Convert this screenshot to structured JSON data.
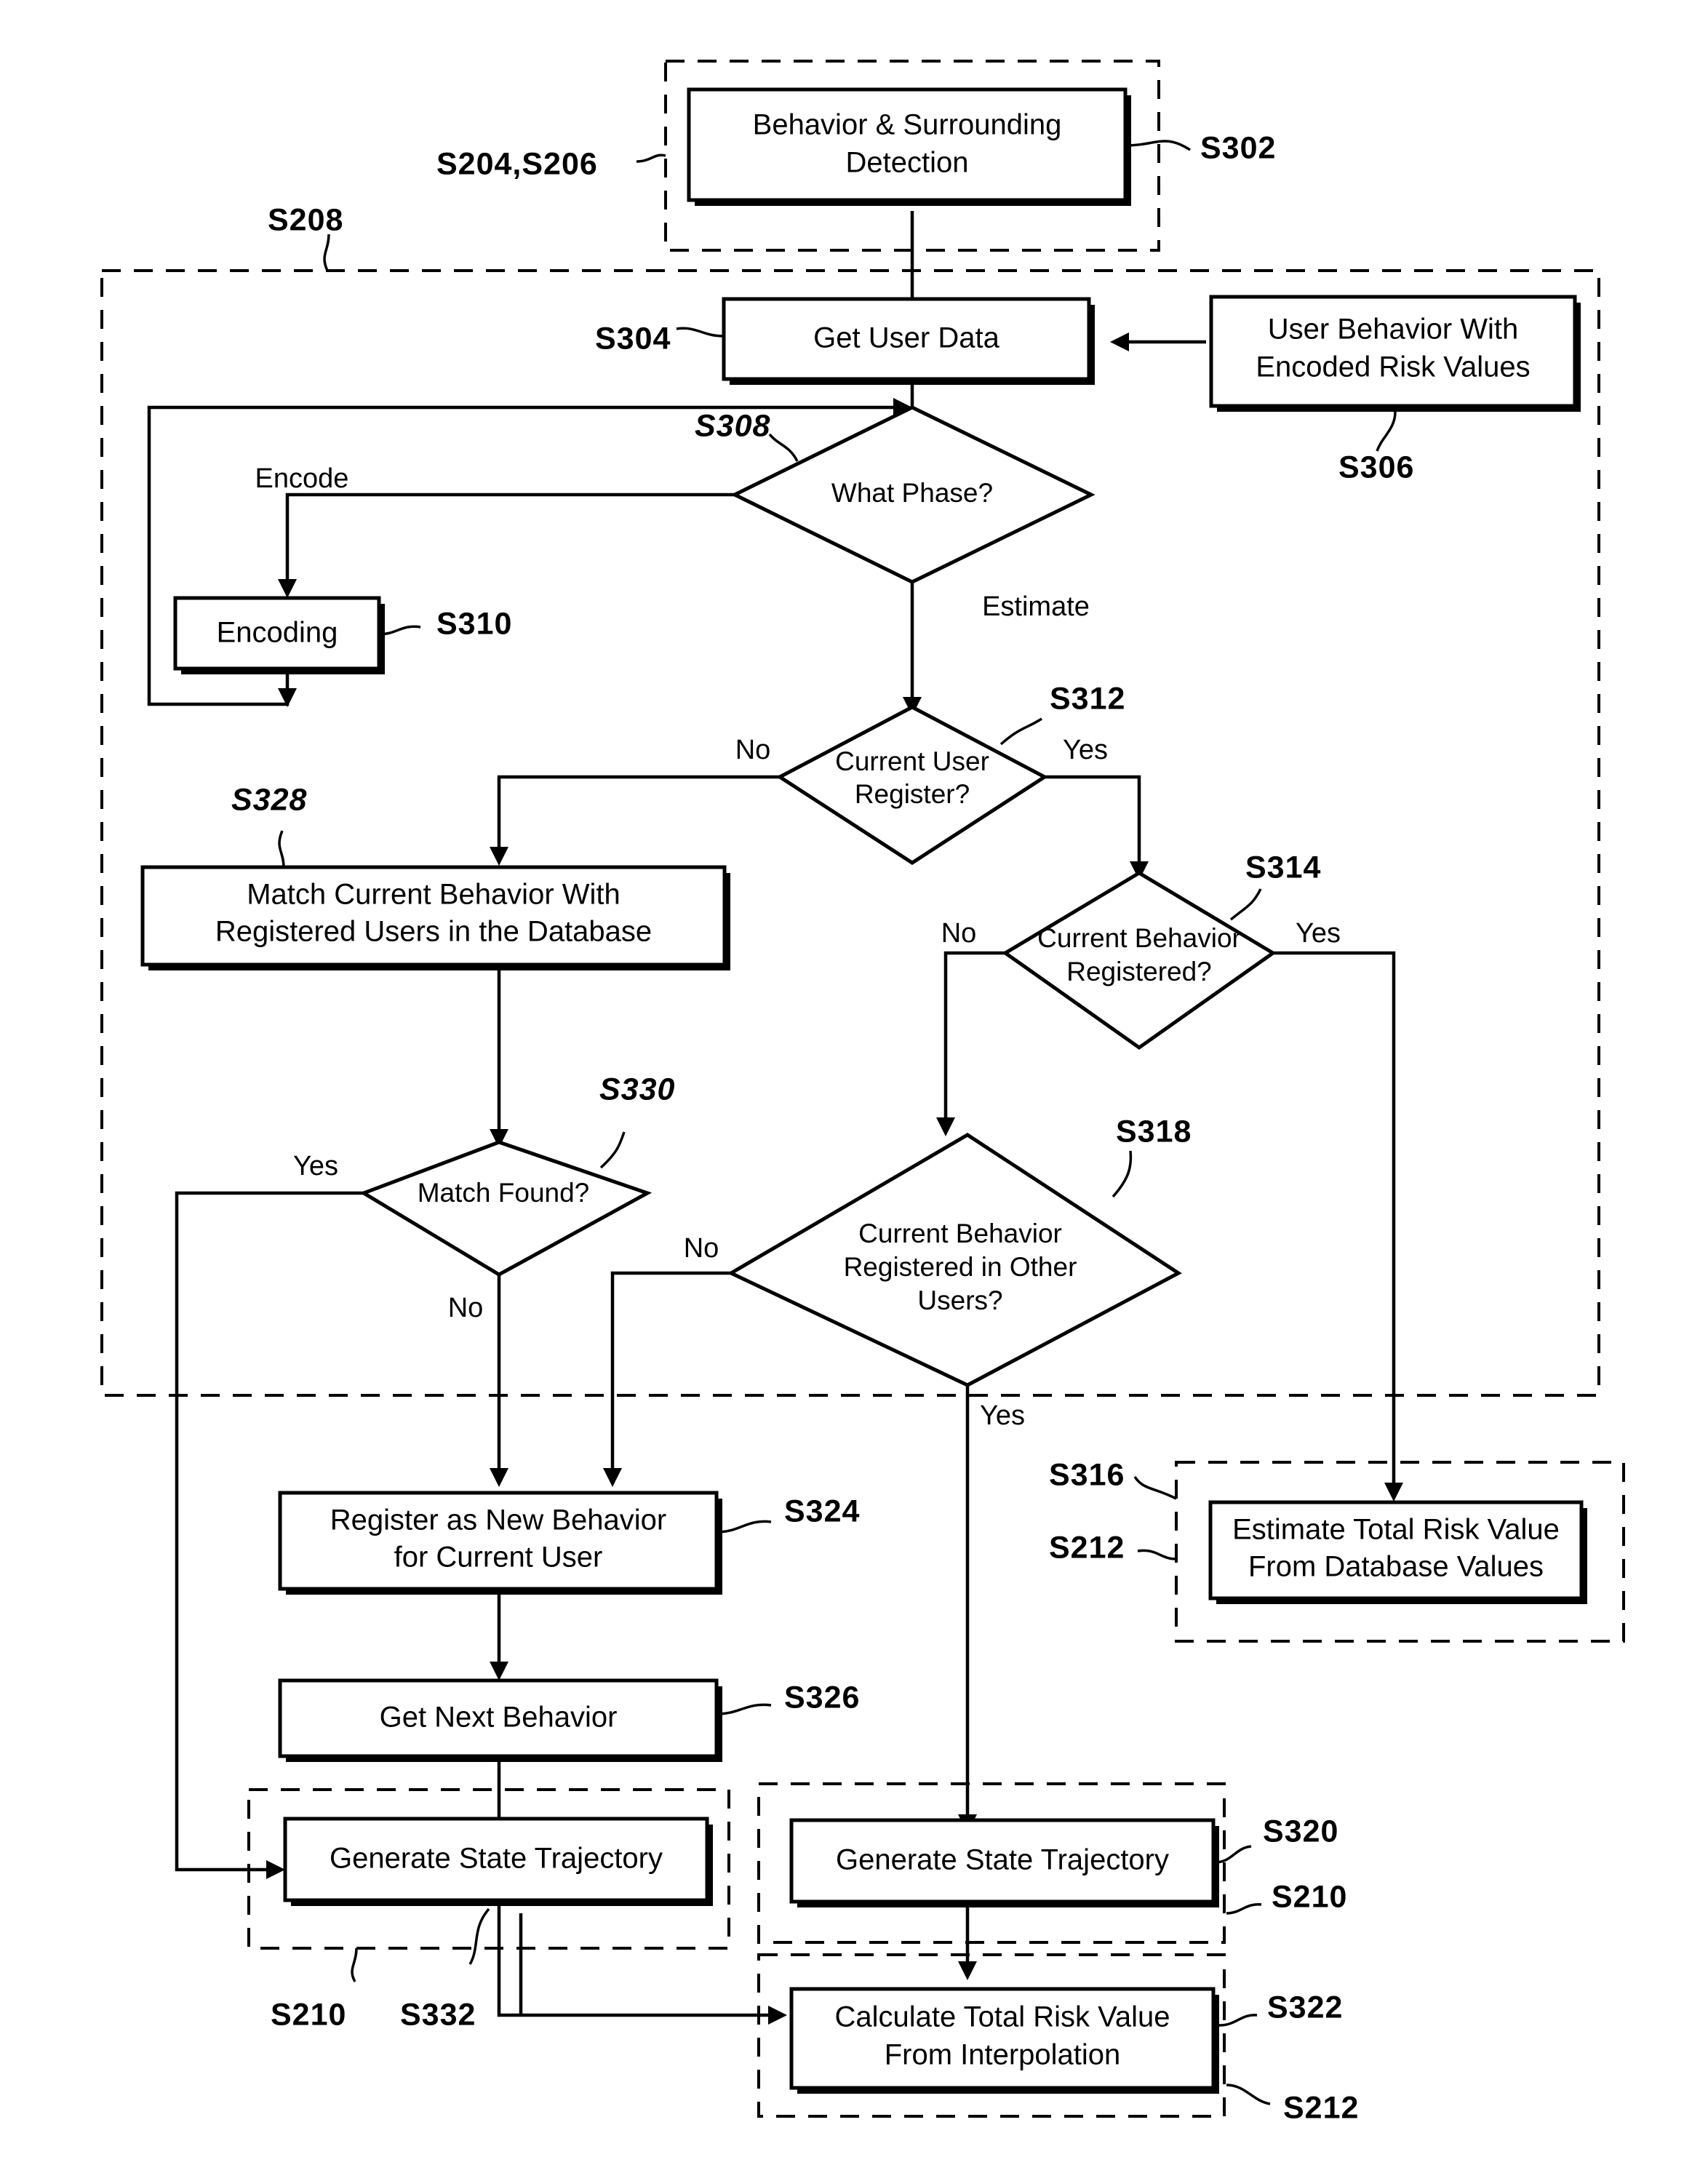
{
  "figure": {
    "type": "patent-flowchart",
    "title": "Behavior risk estimation flowchart"
  },
  "nodes": {
    "n302": {
      "label_line1": "Behavior & Surrounding",
      "label_line2": "Detection",
      "ref": "S302"
    },
    "n304": {
      "label": "Get User Data",
      "ref": "S304"
    },
    "n306": {
      "label_line1": "User Behavior With",
      "label_line2": "Encoded Risk Values",
      "ref": "S306"
    },
    "n308": {
      "label": "What Phase?",
      "ref": "S308"
    },
    "n310": {
      "label": "Encoding",
      "ref": "S310"
    },
    "n312": {
      "label_line1": "Current User",
      "label_line2": "Register?",
      "ref": "S312"
    },
    "n314": {
      "label_line1": "Current Behavior",
      "label_line2": "Registered?",
      "ref": "S314"
    },
    "n316": {
      "label_line1": "Estimate Total Risk Value",
      "label_line2": "From Database Values",
      "ref": "S316",
      "ref2": "S212"
    },
    "n318": {
      "label_line1": "Current Behavior",
      "label_line2": "Registered in Other",
      "label_line3": "Users?",
      "ref": "S318"
    },
    "n320": {
      "label": "Generate State Trajectory",
      "ref": "S320",
      "ref2": "S210"
    },
    "n322": {
      "label_line1": "Calculate Total Risk Value",
      "label_line2": "From Interpolation",
      "ref": "S322",
      "ref2": "S212"
    },
    "n324": {
      "label_line1": "Register as New Behavior",
      "label_line2": "for Current User",
      "ref": "S324"
    },
    "n326": {
      "label": "Get Next Behavior",
      "ref": "S326"
    },
    "n328": {
      "label_line1": "Match Current Behavior With",
      "label_line2": "Registered Users in the Database",
      "ref": "S328"
    },
    "n330": {
      "label": "Match Found?",
      "ref": "S330"
    },
    "n332": {
      "label": "Generate State Trajectory",
      "ref": "S332",
      "ref2": "S210"
    }
  },
  "groups": {
    "g_detect": {
      "ref": "S204,S206"
    },
    "g_main": {
      "ref": "S208"
    }
  },
  "edge_labels": {
    "encode": "Encode",
    "estimate": "Estimate",
    "s312_no": "No",
    "s312_yes": "Yes",
    "s314_no": "No",
    "s314_yes": "Yes",
    "s318_no": "No",
    "s318_yes": "Yes",
    "s330_yes": "Yes",
    "s330_no": "No"
  },
  "colors": {
    "ink": "#000000",
    "paper": "#ffffff"
  }
}
